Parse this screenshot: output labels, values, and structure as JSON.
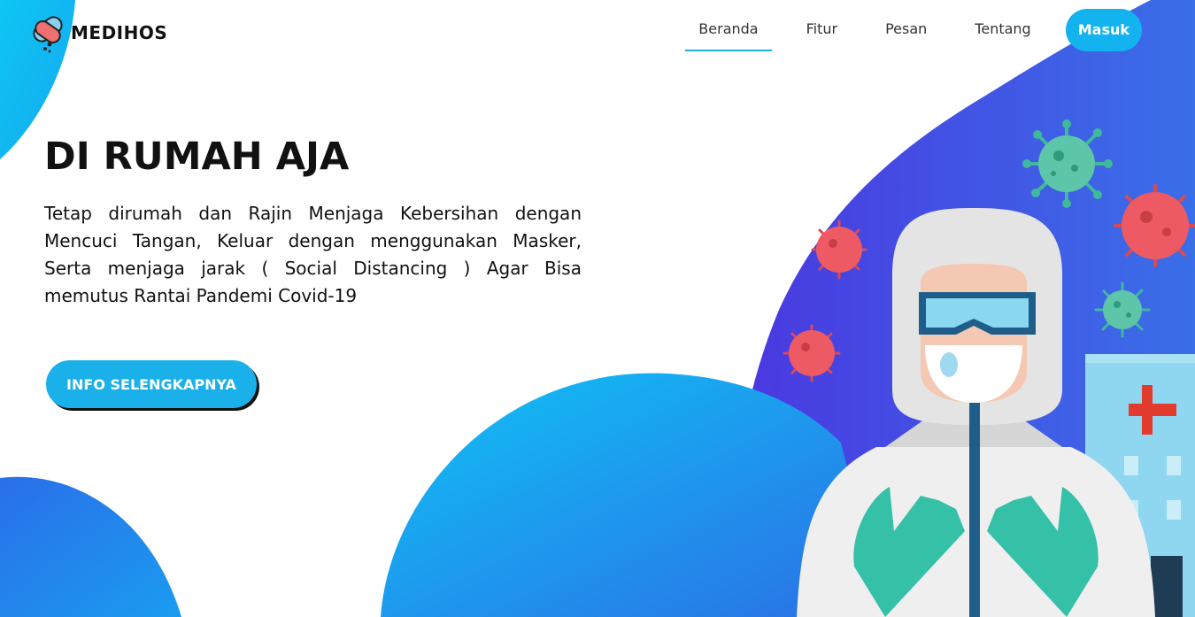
{
  "brand": {
    "name": "MEDIHOS",
    "logo_icon": "capsule-logo-icon"
  },
  "nav": {
    "items": [
      {
        "label": "Beranda",
        "active": true
      },
      {
        "label": "Fitur",
        "active": false
      },
      {
        "label": "Pesan",
        "active": false
      },
      {
        "label": "Tentang",
        "active": false
      }
    ],
    "login_label": "Masuk"
  },
  "hero": {
    "title": "DI RUMAH AJA",
    "description": "Tetap dirumah dan Rajin Menjaga Kebersihan dengan Mencuci Tangan, Keluar dengan menggunakan Masker, Serta menjaga jarak ( Social Distancing ) Agar Bisa memutus Rantai Pandemi Covid-19",
    "cta_label": "INFO SELENGKAPNYA"
  },
  "colors": {
    "accent": "#1ab0ea",
    "blob_purple": "#4a3fe0",
    "blob_blue": "#1aa8ef",
    "virus_red": "#ee5a63",
    "virus_green": "#3fb99a"
  }
}
